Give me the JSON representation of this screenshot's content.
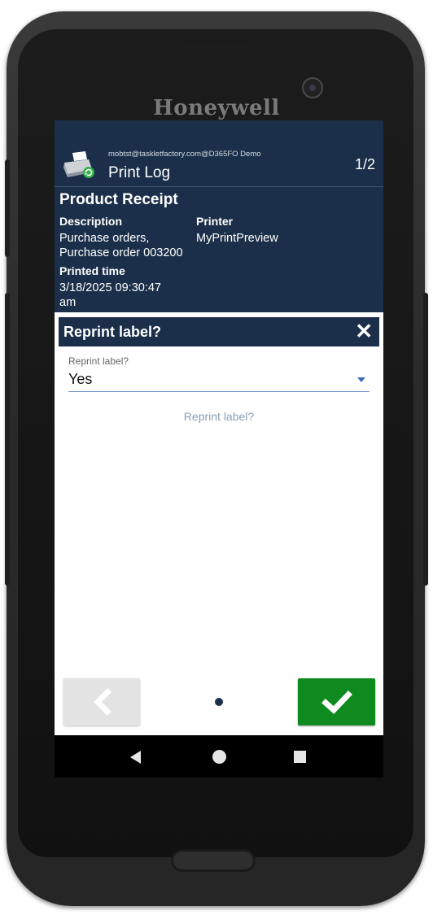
{
  "device": {
    "brand": "Honeywell"
  },
  "header": {
    "account": "mobtst@taskletfactory.com@D365FO Demo",
    "app_title": "Print Log",
    "pager": "1/2",
    "printer_icon": "printer-refresh-icon"
  },
  "record": {
    "section_title": "Product Receipt",
    "description_label": "Description",
    "description_value_line1": "Purchase orders,",
    "description_value_line2": "Purchase order 003200",
    "printer_label": "Printer",
    "printer_value": "MyPrintPreview",
    "printed_time_label": "Printed time",
    "printed_time_value_line1": "3/18/2025 09:30:47",
    "printed_time_value_line2": "am"
  },
  "dialog": {
    "title": "Reprint label?",
    "close_icon": "close-icon",
    "field_caption": "Reprint label?",
    "field_value": "Yes",
    "hint": "Reprint label?"
  },
  "footer": {
    "back_icon": "chevron-left-icon",
    "confirm_icon": "check-icon",
    "back_color": "#e3e3e3",
    "confirm_color": "#0f8a1e"
  },
  "colors": {
    "header_bg": "#1b2f4a",
    "accent": "#3f6bb5"
  }
}
